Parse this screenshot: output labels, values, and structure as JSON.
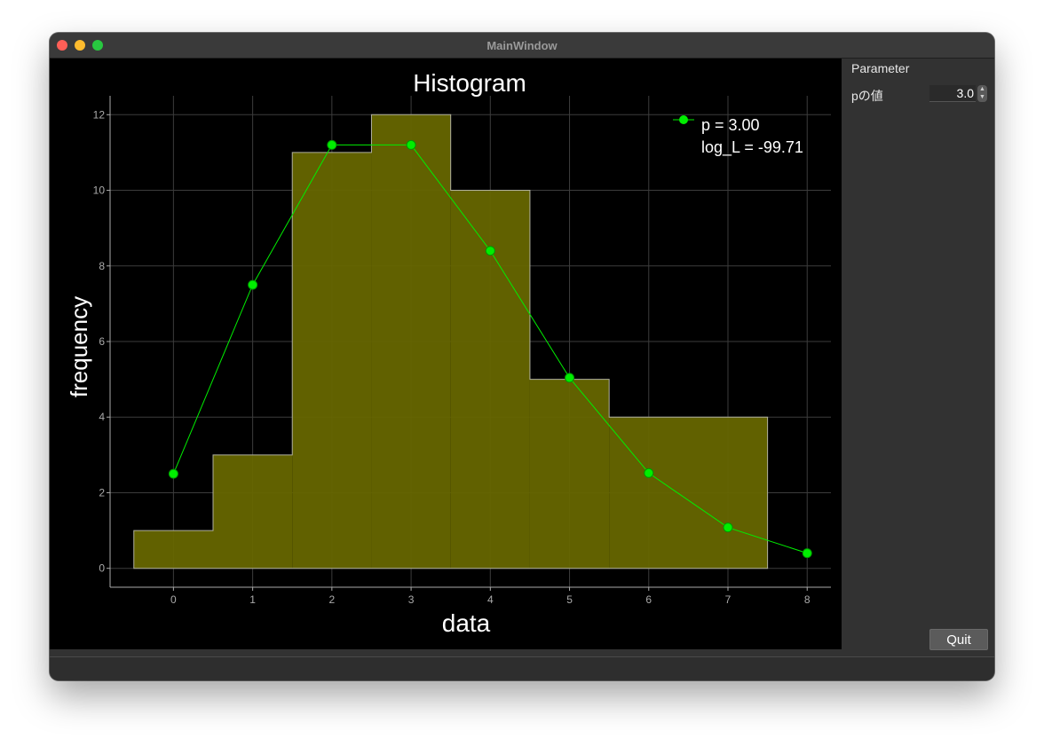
{
  "window": {
    "title": "MainWindow"
  },
  "panel": {
    "group_label": "Parameter",
    "p_label": "pの値",
    "p_value": "3.0",
    "quit_label": "Quit"
  },
  "chart_data": {
    "type": "bar",
    "title": "Histogram",
    "xlabel": "data",
    "ylabel": "frequency",
    "x_ticks": [
      0,
      1,
      2,
      3,
      4,
      5,
      6,
      7,
      8
    ],
    "y_ticks": [
      0,
      2,
      4,
      6,
      8,
      10,
      12
    ],
    "xlim": [
      -0.8,
      8.3
    ],
    "ylim": [
      -0.5,
      12.5
    ],
    "grid": true,
    "histogram": {
      "bin_edges": [
        -0.5,
        0.5,
        1.5,
        2.5,
        3.5,
        4.5,
        5.5,
        7.5
      ],
      "counts": [
        1,
        3,
        11,
        12,
        10,
        5,
        4
      ],
      "color": "#666600"
    },
    "series": [
      {
        "type": "line",
        "x": [
          0,
          1,
          2,
          3,
          4,
          5,
          6,
          7,
          8
        ],
        "y": [
          2.5,
          7.5,
          11.2,
          11.2,
          8.4,
          5.04,
          2.52,
          1.08,
          0.4
        ],
        "color": "#00ee00"
      }
    ],
    "legend": {
      "position": "top-right",
      "lines": [
        "p = 3.00",
        "log_L = -99.71"
      ]
    }
  }
}
